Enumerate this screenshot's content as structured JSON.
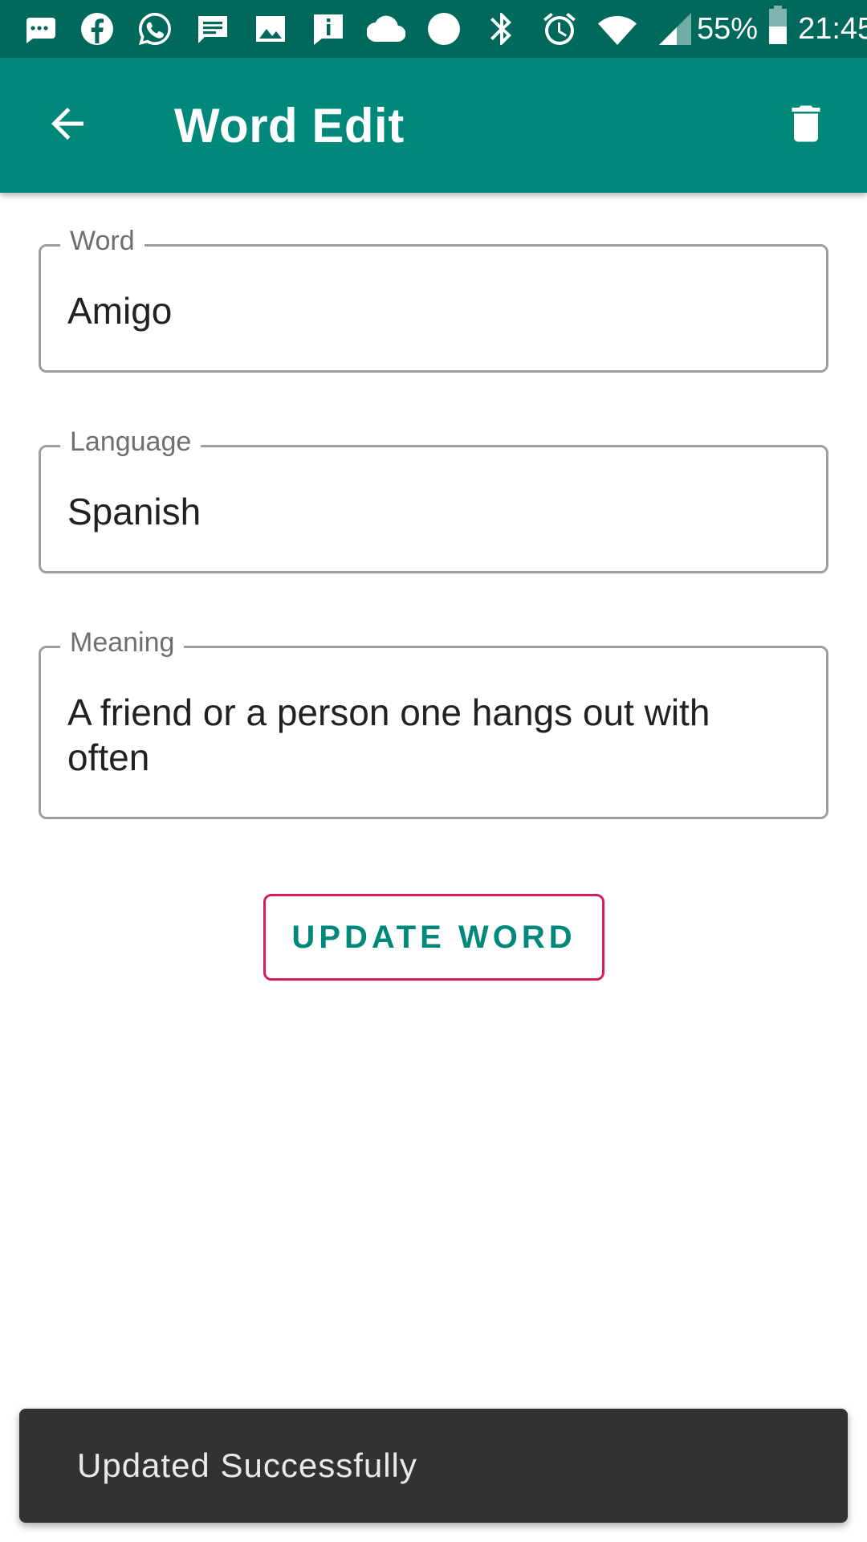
{
  "status_bar": {
    "icons": [
      "messages-icon",
      "facebook-icon",
      "whatsapp-icon",
      "chat-icon",
      "image-icon",
      "info-icon",
      "cloud-icon",
      "circle-icon",
      "bluetooth-icon",
      "alarm-icon",
      "wifi-icon",
      "signal-icon"
    ],
    "battery_percent": "55%",
    "time": "21:45"
  },
  "appbar": {
    "title": "Word Edit",
    "back_icon": "arrow-back-icon",
    "delete_icon": "trash-icon"
  },
  "form": {
    "word": {
      "label": "Word",
      "value": "Amigo"
    },
    "language": {
      "label": "Language",
      "value": "Spanish"
    },
    "meaning": {
      "label": "Meaning",
      "value": "A friend or a person one hangs out with often"
    }
  },
  "update_button": {
    "label": "UPDATE WORD"
  },
  "snackbar": {
    "message": "Updated Successfully"
  },
  "colors": {
    "primary": "#00897b",
    "primary_dark": "#00695c",
    "accent": "#d81b60",
    "snackbar": "#323232"
  }
}
